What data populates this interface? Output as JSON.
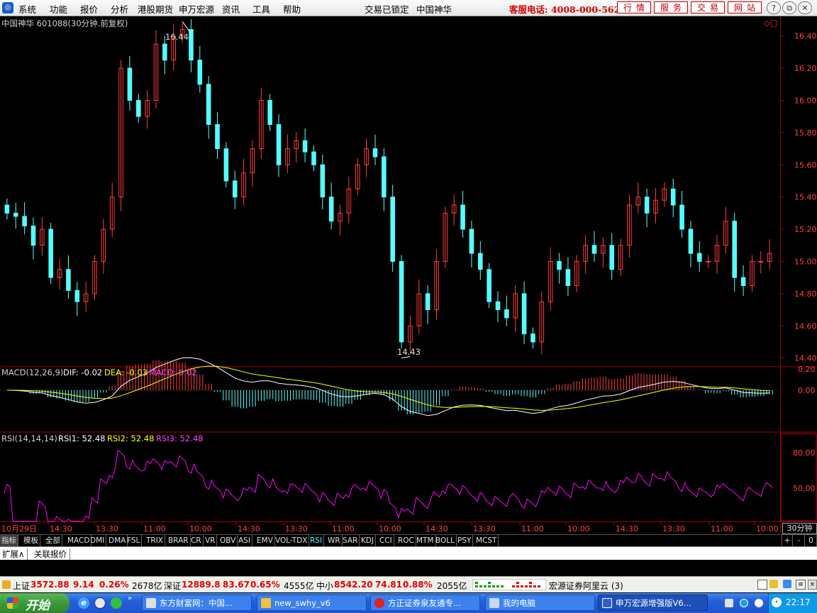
{
  "menu": {
    "items": [
      "系统",
      "功能",
      "报价",
      "分析",
      "港股期货",
      "申万宏源",
      "资讯",
      "工具",
      "帮助"
    ],
    "lock_status": "交易已锁定",
    "stock_name": "中国神华",
    "hotline": "客服电话: 4008-000-562",
    "right_buttons": [
      "行情",
      "服务",
      "交易",
      "网站"
    ]
  },
  "chart": {
    "title": "中国神华 601088(30分钟.前复权)",
    "high_label": "16.44",
    "low_label": "14.43",
    "price_ticks": [
      "16.40",
      "16.20",
      "16.00",
      "15.80",
      "15.60",
      "15.40",
      "15.20",
      "15.00",
      "14.80",
      "14.60",
      "14.40"
    ],
    "macd": {
      "name": "MACD(12,26,9)",
      "dif": "DIF: -0.02",
      "dea": "DEA: -0.03",
      "macd": "MACD: 0.02",
      "ticks": [
        "0.20",
        "0.00"
      ]
    },
    "rsi": {
      "name": "RSI(14,14,14)",
      "rsi1": "RSI1: 52.48",
      "rsi2": "RSI2: 52.48",
      "rsi3": "RSI3: 52.48",
      "ticks": [
        "80.00",
        "50.00"
      ]
    },
    "time_labels": [
      "10月29日",
      "14:30",
      "13:30",
      "11:00",
      "10:00",
      "14:30",
      "13:30",
      "11:00",
      "10:00",
      "14:30",
      "13:30",
      "11:00",
      "10:00",
      "14:30",
      "13:30",
      "11:00",
      "10:00"
    ],
    "period": "30分钟"
  },
  "chart_data": {
    "type": "candlestick",
    "title": "中国神华 601088(30分钟.前复权)",
    "ylim": [
      14.35,
      16.5
    ],
    "closes": [
      15.3,
      15.28,
      15.22,
      15.1,
      15.2,
      14.9,
      14.95,
      14.82,
      14.75,
      14.8,
      15.0,
      15.2,
      15.4,
      16.2,
      16.0,
      15.9,
      16.0,
      16.35,
      16.25,
      16.4,
      16.44,
      16.25,
      16.1,
      15.85,
      15.7,
      15.5,
      15.4,
      15.55,
      15.7,
      16.0,
      15.85,
      15.6,
      15.7,
      15.75,
      15.68,
      15.6,
      15.4,
      15.25,
      15.3,
      15.45,
      15.6,
      15.7,
      15.65,
      15.4,
      15.0,
      14.5,
      14.6,
      14.8,
      14.7,
      15.0,
      15.3,
      15.35,
      15.2,
      15.05,
      14.95,
      14.75,
      14.7,
      14.65,
      14.8,
      14.55,
      14.5,
      14.75,
      15.0,
      14.95,
      14.85,
      15.0,
      15.1,
      15.05,
      15.1,
      14.95,
      15.1,
      15.35,
      15.4,
      15.3,
      15.38,
      15.45,
      15.35,
      15.2,
      15.05,
      15.0,
      15.0,
      15.1,
      15.25,
      14.9,
      14.85,
      15.0,
      15.0,
      15.05
    ],
    "macd_dif_last": -0.02,
    "macd_dea_last": -0.03,
    "macd_last": 0.02,
    "rsi_last": 52.48
  },
  "tabs": [
    "指标",
    "模板",
    "全部",
    "MACD",
    "DMI",
    "DMA",
    "FSL",
    "TRIX",
    "BRAR",
    "CR",
    "VR",
    "OBV",
    "ASI",
    "EMV",
    "VOL-TDX",
    "RSI",
    "WR",
    "SAR",
    "KDJ",
    "CCI",
    "ROC",
    "MTM",
    "BOLL",
    "PSY",
    "MCST"
  ],
  "tab_controls": [
    "+",
    "-",
    "0"
  ],
  "ext_tabs": [
    "扩展∧",
    "关联报价"
  ],
  "ticker": {
    "sh_name": "上证",
    "sh_val": "3572.88",
    "sh_chg": "9.14",
    "sh_pct": "0.26%",
    "sh_amt": "2678亿",
    "sz_name": "深证",
    "sz_val": "12889.8",
    "sz_chg": "83.67",
    "sz_pct": "0.65%",
    "sz_amt": "4555亿",
    "zx_name": "中小",
    "zx_val": "8542.20",
    "zx_chg": "74.81",
    "zx_pct": "0.88%",
    "zx_amt": "2055亿",
    "broker": "宏源证券阿里云 (3)"
  },
  "taskbar": {
    "start": "开始",
    "tasks": [
      "东方财富网：中国...",
      "new_swhy_v6",
      "方正证券泉友通专...",
      "我的电脑",
      "申万宏源增强版V6..."
    ],
    "clock": "22:17"
  },
  "colors": {
    "up": "#ff3c3c",
    "down": "#54ffff",
    "dif": "#ffffff",
    "dea": "#ffff00",
    "rsi": "#ff00ff",
    "frame": "#a00000"
  }
}
